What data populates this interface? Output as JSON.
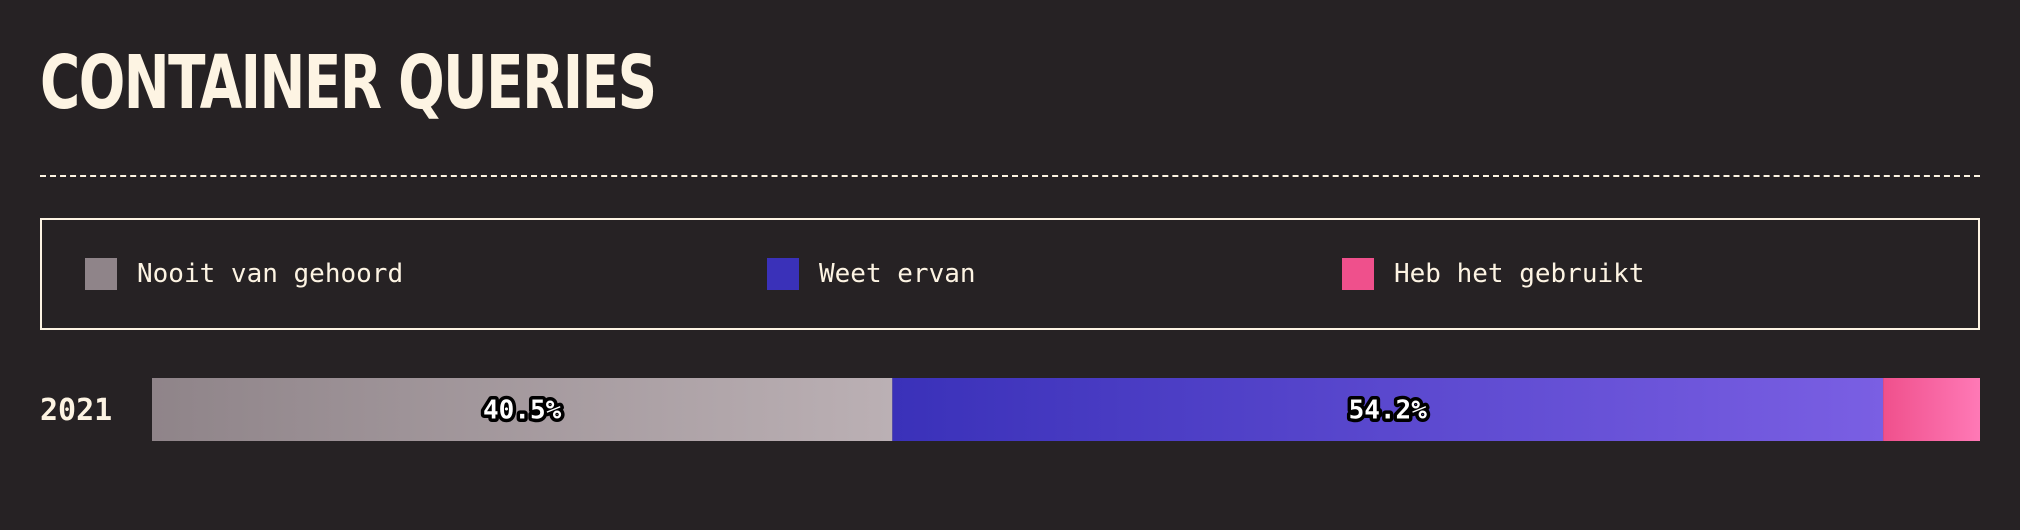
{
  "header": {
    "title": "CONTAINER QUERIES"
  },
  "legend": [
    {
      "label": "Nooit van gehoord",
      "color": "#8f8489"
    },
    {
      "label": "Weet ervan",
      "color": "#3a31b9"
    },
    {
      "label": "Heb het gebruikt",
      "color": "#ef508c"
    }
  ],
  "chart_data": {
    "type": "bar",
    "orientation": "horizontal-stacked",
    "categories": [
      "2021"
    ],
    "series": [
      {
        "name": "Nooit van gehoord",
        "values": [
          40.5
        ],
        "label": "40.5%",
        "color_start": "#8f8489",
        "color_end": "#bbb0b4"
      },
      {
        "name": "Weet ervan",
        "values": [
          54.2
        ],
        "label": "54.2%",
        "color_start": "#3a31b9",
        "color_end": "#7a5fe3"
      },
      {
        "name": "Heb het gebruikt",
        "values": [
          5.3
        ],
        "label": "",
        "color_start": "#ef508c",
        "color_end": "#ff79b6"
      }
    ],
    "xlim": [
      0,
      100
    ],
    "legend_position": "top"
  }
}
